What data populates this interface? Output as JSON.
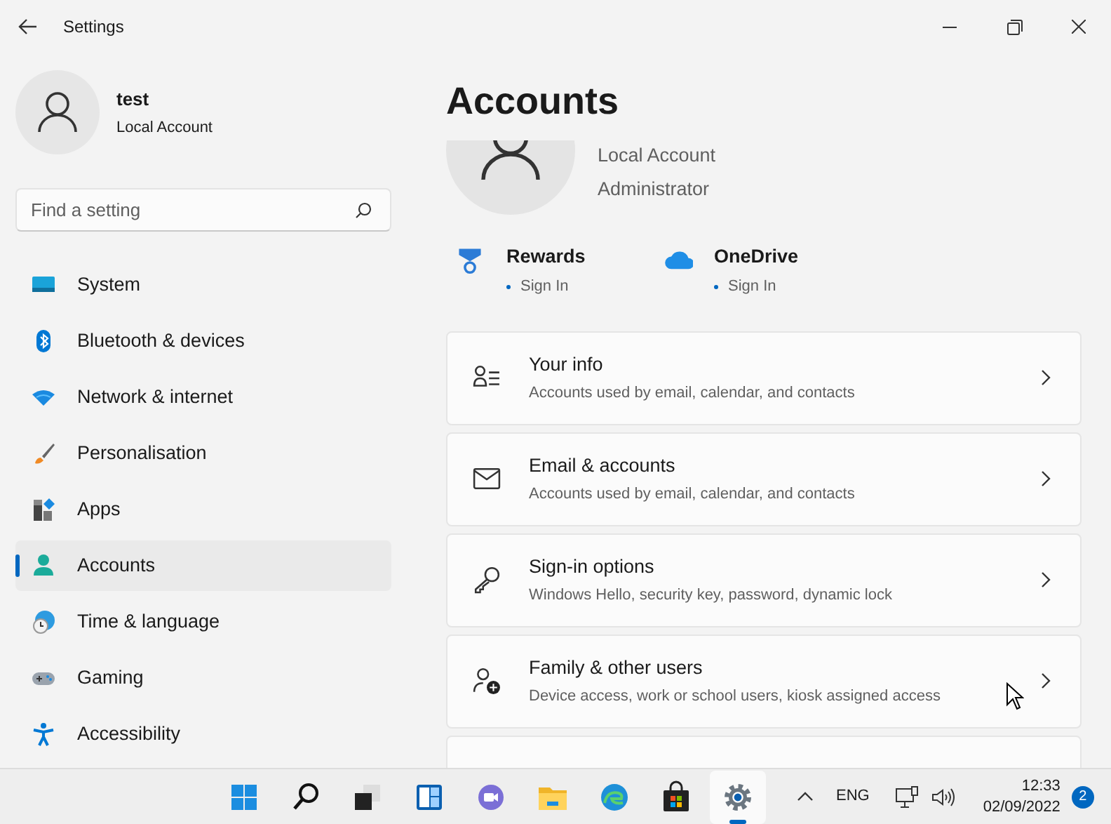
{
  "window": {
    "title": "Settings"
  },
  "user": {
    "name": "test",
    "account_type": "Local Account"
  },
  "search": {
    "placeholder": "Find a setting"
  },
  "nav": [
    {
      "label": "System",
      "selected": false
    },
    {
      "label": "Bluetooth & devices",
      "selected": false
    },
    {
      "label": "Network & internet",
      "selected": false
    },
    {
      "label": "Personalisation",
      "selected": false
    },
    {
      "label": "Apps",
      "selected": false
    },
    {
      "label": "Accounts",
      "selected": true
    },
    {
      "label": "Time & language",
      "selected": false
    },
    {
      "label": "Gaming",
      "selected": false
    },
    {
      "label": "Accessibility",
      "selected": false
    }
  ],
  "page_title": "Accounts",
  "profile": {
    "lines": [
      "Local Account",
      "Administrator"
    ]
  },
  "services": [
    {
      "name": "Rewards",
      "status": "Sign In"
    },
    {
      "name": "OneDrive",
      "status": "Sign In"
    }
  ],
  "cards": [
    {
      "title": "Your info",
      "description": "Accounts used by email, calendar, and contacts"
    },
    {
      "title": "Email & accounts",
      "description": "Accounts used by email, calendar, and contacts"
    },
    {
      "title": "Sign-in options",
      "description": "Windows Hello, security key, password, dynamic lock"
    },
    {
      "title": "Family & other users",
      "description": "Device access, work or school users, kiosk assigned access"
    }
  ],
  "taskbar": {
    "apps": [
      {
        "selected": false
      },
      {
        "selected": false
      },
      {
        "selected": false
      },
      {
        "selected": false
      },
      {
        "selected": false
      },
      {
        "selected": false
      },
      {
        "selected": false
      },
      {
        "selected": false
      },
      {
        "selected": true
      }
    ],
    "language": "ENG",
    "time": "12:33",
    "date": "02/09/2022",
    "notification_count": "2"
  }
}
